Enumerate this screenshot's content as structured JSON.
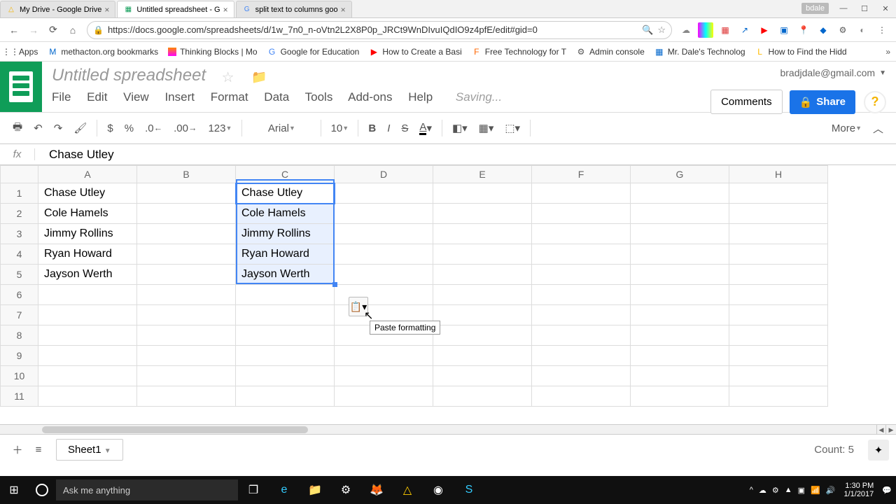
{
  "browser": {
    "tabs": [
      {
        "title": "My Drive - Google Drive",
        "icon": "△"
      },
      {
        "title": "Untitled spreadsheet - G",
        "icon": "▦",
        "active": true
      },
      {
        "title": "split text to columns goo",
        "icon": "G"
      }
    ],
    "user_badge": "bdale",
    "url": "https://docs.google.com/spreadsheets/d/1w_7n0_n-oVtn2L2X8P0p_JRCt9WnDIvuIQdIO9z4pfE/edit#gid=0",
    "bookmarks": [
      {
        "label": "Apps",
        "icon": "⋮⋮"
      },
      {
        "label": "methacton.org bookmarks",
        "icon": "M"
      },
      {
        "label": "Thinking Blocks | Mo",
        "icon": "▦"
      },
      {
        "label": "Google for Education",
        "icon": "G"
      },
      {
        "label": "How to Create a Basi",
        "icon": "▶"
      },
      {
        "label": "Free Technology for T",
        "icon": "F"
      },
      {
        "label": "Admin console",
        "icon": "⚙"
      },
      {
        "label": "Mr. Dale's Technolog",
        "icon": "▦"
      },
      {
        "label": "How to Find the Hidd",
        "icon": "L"
      }
    ]
  },
  "sheets": {
    "doc_title": "Untitled spreadsheet",
    "user_email": "bradjdale@gmail.com",
    "menus": [
      "File",
      "Edit",
      "View",
      "Insert",
      "Format",
      "Data",
      "Tools",
      "Add-ons",
      "Help"
    ],
    "status": "Saving...",
    "comments_label": "Comments",
    "share_label": "Share",
    "toolbar": {
      "font": "Arial",
      "size": "10",
      "fmt123": "123",
      "currency": "$",
      "percent": "%",
      "dec_dec": ".0←",
      "dec_inc": ".00",
      "bold": "B",
      "italic": "I",
      "strike": "S",
      "more": "More"
    },
    "formula_value": "Chase Utley",
    "columns": [
      "A",
      "B",
      "C",
      "D",
      "E",
      "F",
      "G",
      "H"
    ],
    "rows": [
      1,
      2,
      3,
      4,
      5,
      6,
      7,
      8,
      9,
      10,
      11
    ],
    "cells": {
      "A": [
        "Chase Utley",
        "Cole Hamels",
        "Jimmy Rollins",
        "Ryan Howard",
        "Jayson Werth"
      ],
      "C": [
        "Chase Utley",
        "Cole Hamels",
        "Jimmy Rollins",
        "Ryan Howard",
        "Jayson Werth"
      ]
    },
    "paste_tooltip": "Paste formatting",
    "sheet_tab": "Sheet1",
    "count_label": "Count: 5"
  },
  "taskbar": {
    "search_placeholder": "Ask me anything",
    "time": "1:30 PM",
    "date": "1/1/2017"
  }
}
